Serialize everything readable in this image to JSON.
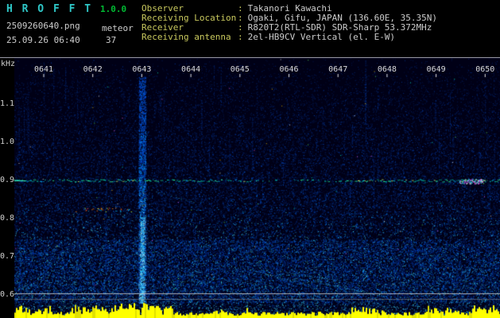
{
  "colors": {
    "background": "#000000",
    "title": "#2fc7c7",
    "version": "#00bb33",
    "info_label": "#c9c95e",
    "info_value": "#cccccc",
    "axis_text": "#d0d0d0",
    "carrier_trace": "#00e0c0",
    "level_bars": "#ffff00",
    "noise_deep": "#000016"
  },
  "header": {
    "title": "H R O F F T",
    "version": "1.0.0",
    "filename": "2509260640.png",
    "mode": "meteor",
    "datetime": "25.09.26 06:40",
    "count": "37",
    "colon": ":",
    "info": [
      {
        "label": "Observer",
        "value": "Takanori Kawachi"
      },
      {
        "label": "Receiving Location",
        "value": "Ogaki, Gifu, JAPAN (136.60E, 35.35N)"
      },
      {
        "label": "Receiver",
        "value": "R820T2(RTL-SDR) SDR-Sharp 53.372MHz"
      },
      {
        "label": "Receiving antenna",
        "value": "2el-HB9CV Vertical (el. E-W)"
      }
    ]
  },
  "chart_data": {
    "type": "heatmap",
    "subtype": "radio-meteor-spectrogram",
    "title": "HROFFT 10-minute audio spectrogram 06:40-06:50",
    "ylabel": "kHz",
    "y_ticks": [
      "1.1",
      "1.0",
      "0.9",
      "0.8",
      "0.7",
      "0.6"
    ],
    "y_range_khz": [
      0.55,
      1.21
    ],
    "x_ticks": [
      "0641",
      "0642",
      "0643",
      "0644",
      "0645",
      "0646",
      "0647",
      "0648",
      "0649",
      "0650"
    ],
    "x_axis": "time (HHMM, 1-minute ticks)",
    "grid": "off",
    "legend": "off",
    "features": {
      "carrier_line_khz": 0.9,
      "event_columns_hhmm": [
        "0643"
      ],
      "echo_blob": {
        "time": "0649.6",
        "khz": 0.9
      },
      "diagonal_traces_region": {
        "time_start": "0645",
        "time_end": "0647.5",
        "khz_high": 0.68,
        "khz_low": 0.6
      },
      "reference_lines_khz": [
        0.605,
        0.59
      ],
      "bottom_strip": "signal-level bars (yellow)"
    }
  }
}
